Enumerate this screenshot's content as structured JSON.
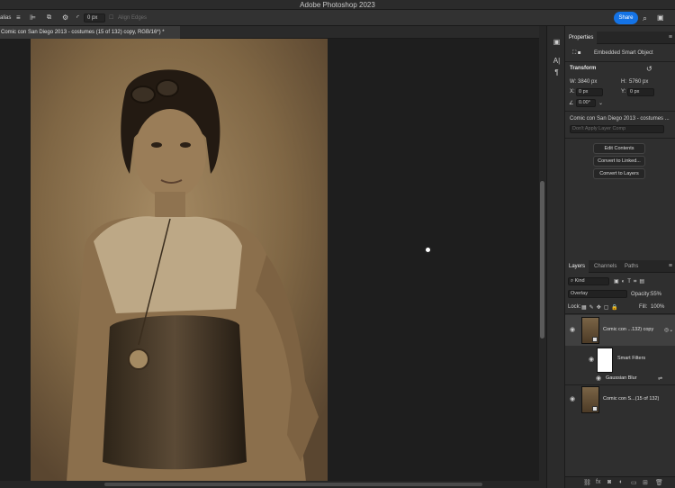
{
  "app": {
    "title": "Adobe Photoshop 2023"
  },
  "options_bar": {
    "left_label": "alias",
    "offset_value": "0 px",
    "align_edges_label": "Align Edges",
    "share_label": "Share"
  },
  "document": {
    "tab_title": "Comic con San Diego 2013 - costumes (15 of 132) copy, RGB/16*) *"
  },
  "dock": {
    "icons": [
      "layer-comps-icon",
      "character-icon",
      "paragraph-icon"
    ]
  },
  "properties": {
    "tab_label": "Properties",
    "object_type": "Embedded Smart Object",
    "transform_heading": "Transform",
    "w_label": "W:",
    "w_value": "3840 px",
    "h_label": "H:",
    "h_value": "5760 px",
    "x_label": "X:",
    "x_value": "0 px",
    "y_label": "Y:",
    "y_value": "0 px",
    "angle_value": "0.00°",
    "source_name": "Comic con San Diego 2013 - costumes ...",
    "layer_comp_placeholder": "Don't Apply Layer Comp",
    "buttons": [
      "Edit Contents",
      "Convert to Linked...",
      "Convert to Layers"
    ]
  },
  "layers_panel": {
    "tabs": [
      "Layers",
      "Channels",
      "Paths"
    ],
    "filter_kind": "Kind",
    "blend_mode": "Overlay",
    "opacity_label": "Opacity:",
    "opacity_value": "55%",
    "lock_label": "Lock:",
    "fill_label": "Fill:",
    "fill_value": "100%",
    "layers": [
      {
        "name": "Comic con ...132) copy",
        "selected": true
      },
      {
        "name": "Smart Filters"
      },
      {
        "name": "Gaussian Blur"
      },
      {
        "name": "Comic con S...(15 of 132)"
      }
    ]
  },
  "colors": {
    "accent": "#1473e6",
    "panel_bg": "#2f2f2f",
    "canvas_bg": "#1e1e1e"
  }
}
